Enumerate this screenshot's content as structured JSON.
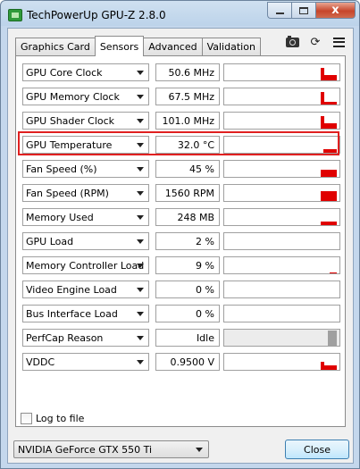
{
  "window": {
    "title": "TechPowerUp GPU-Z 2.8.0",
    "controls": {
      "minimize": "",
      "maximize": "",
      "close": "x"
    }
  },
  "tabs": [
    {
      "label": "Graphics Card",
      "active": false
    },
    {
      "label": "Sensors",
      "active": true
    },
    {
      "label": "Advanced",
      "active": false
    },
    {
      "label": "Validation",
      "active": false
    }
  ],
  "toolbar_icons": [
    "camera-icon",
    "refresh-icon",
    "menu-icon"
  ],
  "sensors": [
    {
      "name": "GPU Core Clock",
      "value": "50.6 MHz"
    },
    {
      "name": "GPU Memory Clock",
      "value": "67.5 MHz"
    },
    {
      "name": "GPU Shader Clock",
      "value": "101.0 MHz"
    },
    {
      "name": "GPU Temperature",
      "value": "32.0 °C",
      "highlighted": true
    },
    {
      "name": "Fan Speed (%)",
      "value": "45 %"
    },
    {
      "name": "Fan Speed (RPM)",
      "value": "1560 RPM"
    },
    {
      "name": "Memory Used",
      "value": "248 MB"
    },
    {
      "name": "GPU Load",
      "value": "2 %"
    },
    {
      "name": "Memory Controller Load",
      "value": "9 %"
    },
    {
      "name": "Video Engine Load",
      "value": "0 %"
    },
    {
      "name": "Bus Interface Load",
      "value": "0 %"
    },
    {
      "name": "PerfCap Reason",
      "value": "Idle"
    },
    {
      "name": "VDDC",
      "value": "0.9500 V"
    }
  ],
  "log_to_file": {
    "label": "Log to file",
    "checked": false
  },
  "gpu_select": {
    "value": "NVIDIA GeForce GTX 550 Ti"
  },
  "close_button": {
    "label": "Close"
  },
  "colors": {
    "graph": "#e00000",
    "highlight": "#e02020",
    "perfcap": "#a0a0a0"
  }
}
